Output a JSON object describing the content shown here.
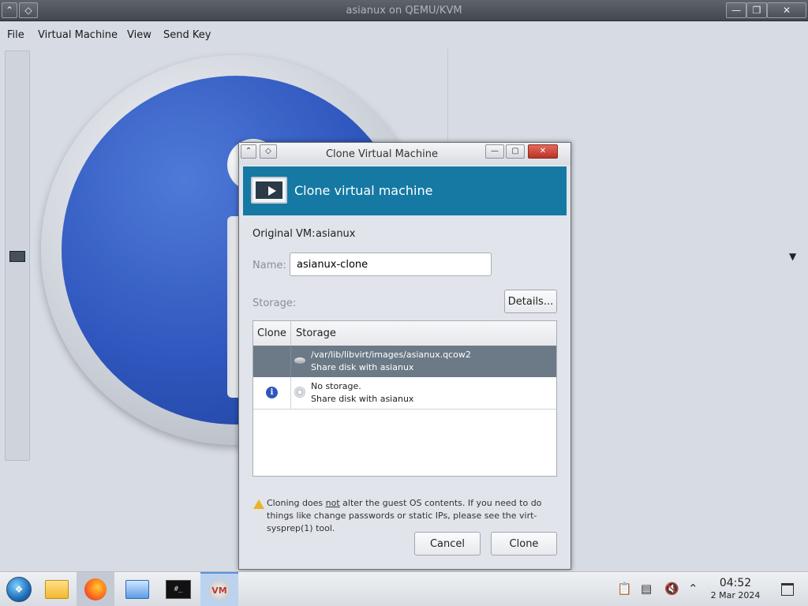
{
  "main_window": {
    "title": "asianux on QEMU/KVM",
    "menu": [
      "File",
      "Virtual Machine",
      "View",
      "Send Key"
    ],
    "controls": {
      "minimize": "—",
      "maximize": "❐",
      "close": "✕"
    }
  },
  "dialog": {
    "window_title": "Clone Virtual Machine",
    "header_title": "Clone virtual machine",
    "original_vm_label": "Original VM:",
    "original_vm_value": "asianux",
    "name_label": "Name:",
    "name_value": "asianux-clone",
    "storage_label": "Storage:",
    "details_button": "Details...",
    "table": {
      "columns": [
        "Clone",
        "Storage"
      ],
      "rows": [
        {
          "line1": "/var/lib/libvirt/images/asianux.qcow2",
          "line2": "Share disk with asianux",
          "selected": true,
          "icon": "disk-icon"
        },
        {
          "line1": "No storage.",
          "line2": "Share disk with asianux",
          "selected": false,
          "icon": "cdrom-icon",
          "clone_icon": "i"
        }
      ]
    },
    "warning_prefix": "Cloning does ",
    "warning_emphasis": "not",
    "warning_suffix": " alter the guest OS contents. If you need to do things like change passwords or static IPs, please see the virt-sysprep(1) tool.",
    "cancel_button": "Cancel",
    "clone_button": "Clone"
  },
  "taskbar": {
    "clock_time": "04:52",
    "clock_date": "2 Mar 2024",
    "terminal_label": "#_"
  }
}
